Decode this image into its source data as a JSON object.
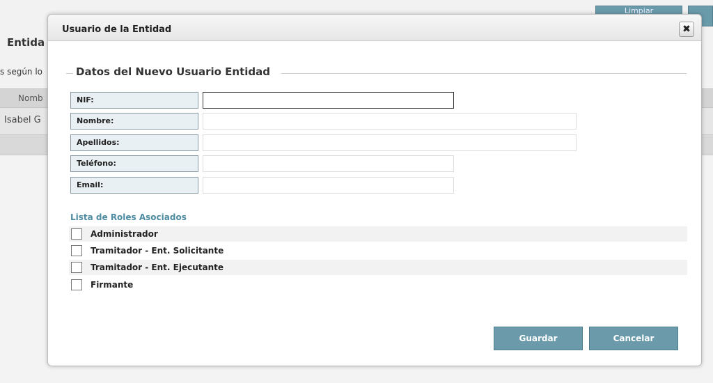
{
  "background": {
    "limpiar_label": "Limpiar",
    "heading_fragment": "Entida",
    "subtitle_fragment": "s según lo",
    "column_fragment": "Nomb",
    "cell_fragment": "Isabel  G"
  },
  "dialog": {
    "title": "Usuario de la Entidad",
    "close_symbol": "✖",
    "section_legend": "Datos del Nuevo Usuario Entidad",
    "fields": [
      {
        "label": "NIF:",
        "value": ""
      },
      {
        "label": "Nombre:",
        "value": ""
      },
      {
        "label": "Apellidos:",
        "value": ""
      },
      {
        "label": "Teléfono:",
        "value": ""
      },
      {
        "label": "Email:",
        "value": ""
      }
    ],
    "roles_title": "Lista de Roles Asociados",
    "roles": [
      {
        "label": "Administrador",
        "checked": false
      },
      {
        "label": "Tramitador - Ent. Solicitante",
        "checked": false
      },
      {
        "label": "Tramitador - Ent. Ejecutante",
        "checked": false
      },
      {
        "label": "Firmante",
        "checked": false
      }
    ],
    "save_label": "Guardar",
    "cancel_label": "Cancelar"
  },
  "colors": {
    "accent": "#6b9aab",
    "label_bg": "#e9f0f3",
    "roles_title": "#4d8ca3"
  }
}
